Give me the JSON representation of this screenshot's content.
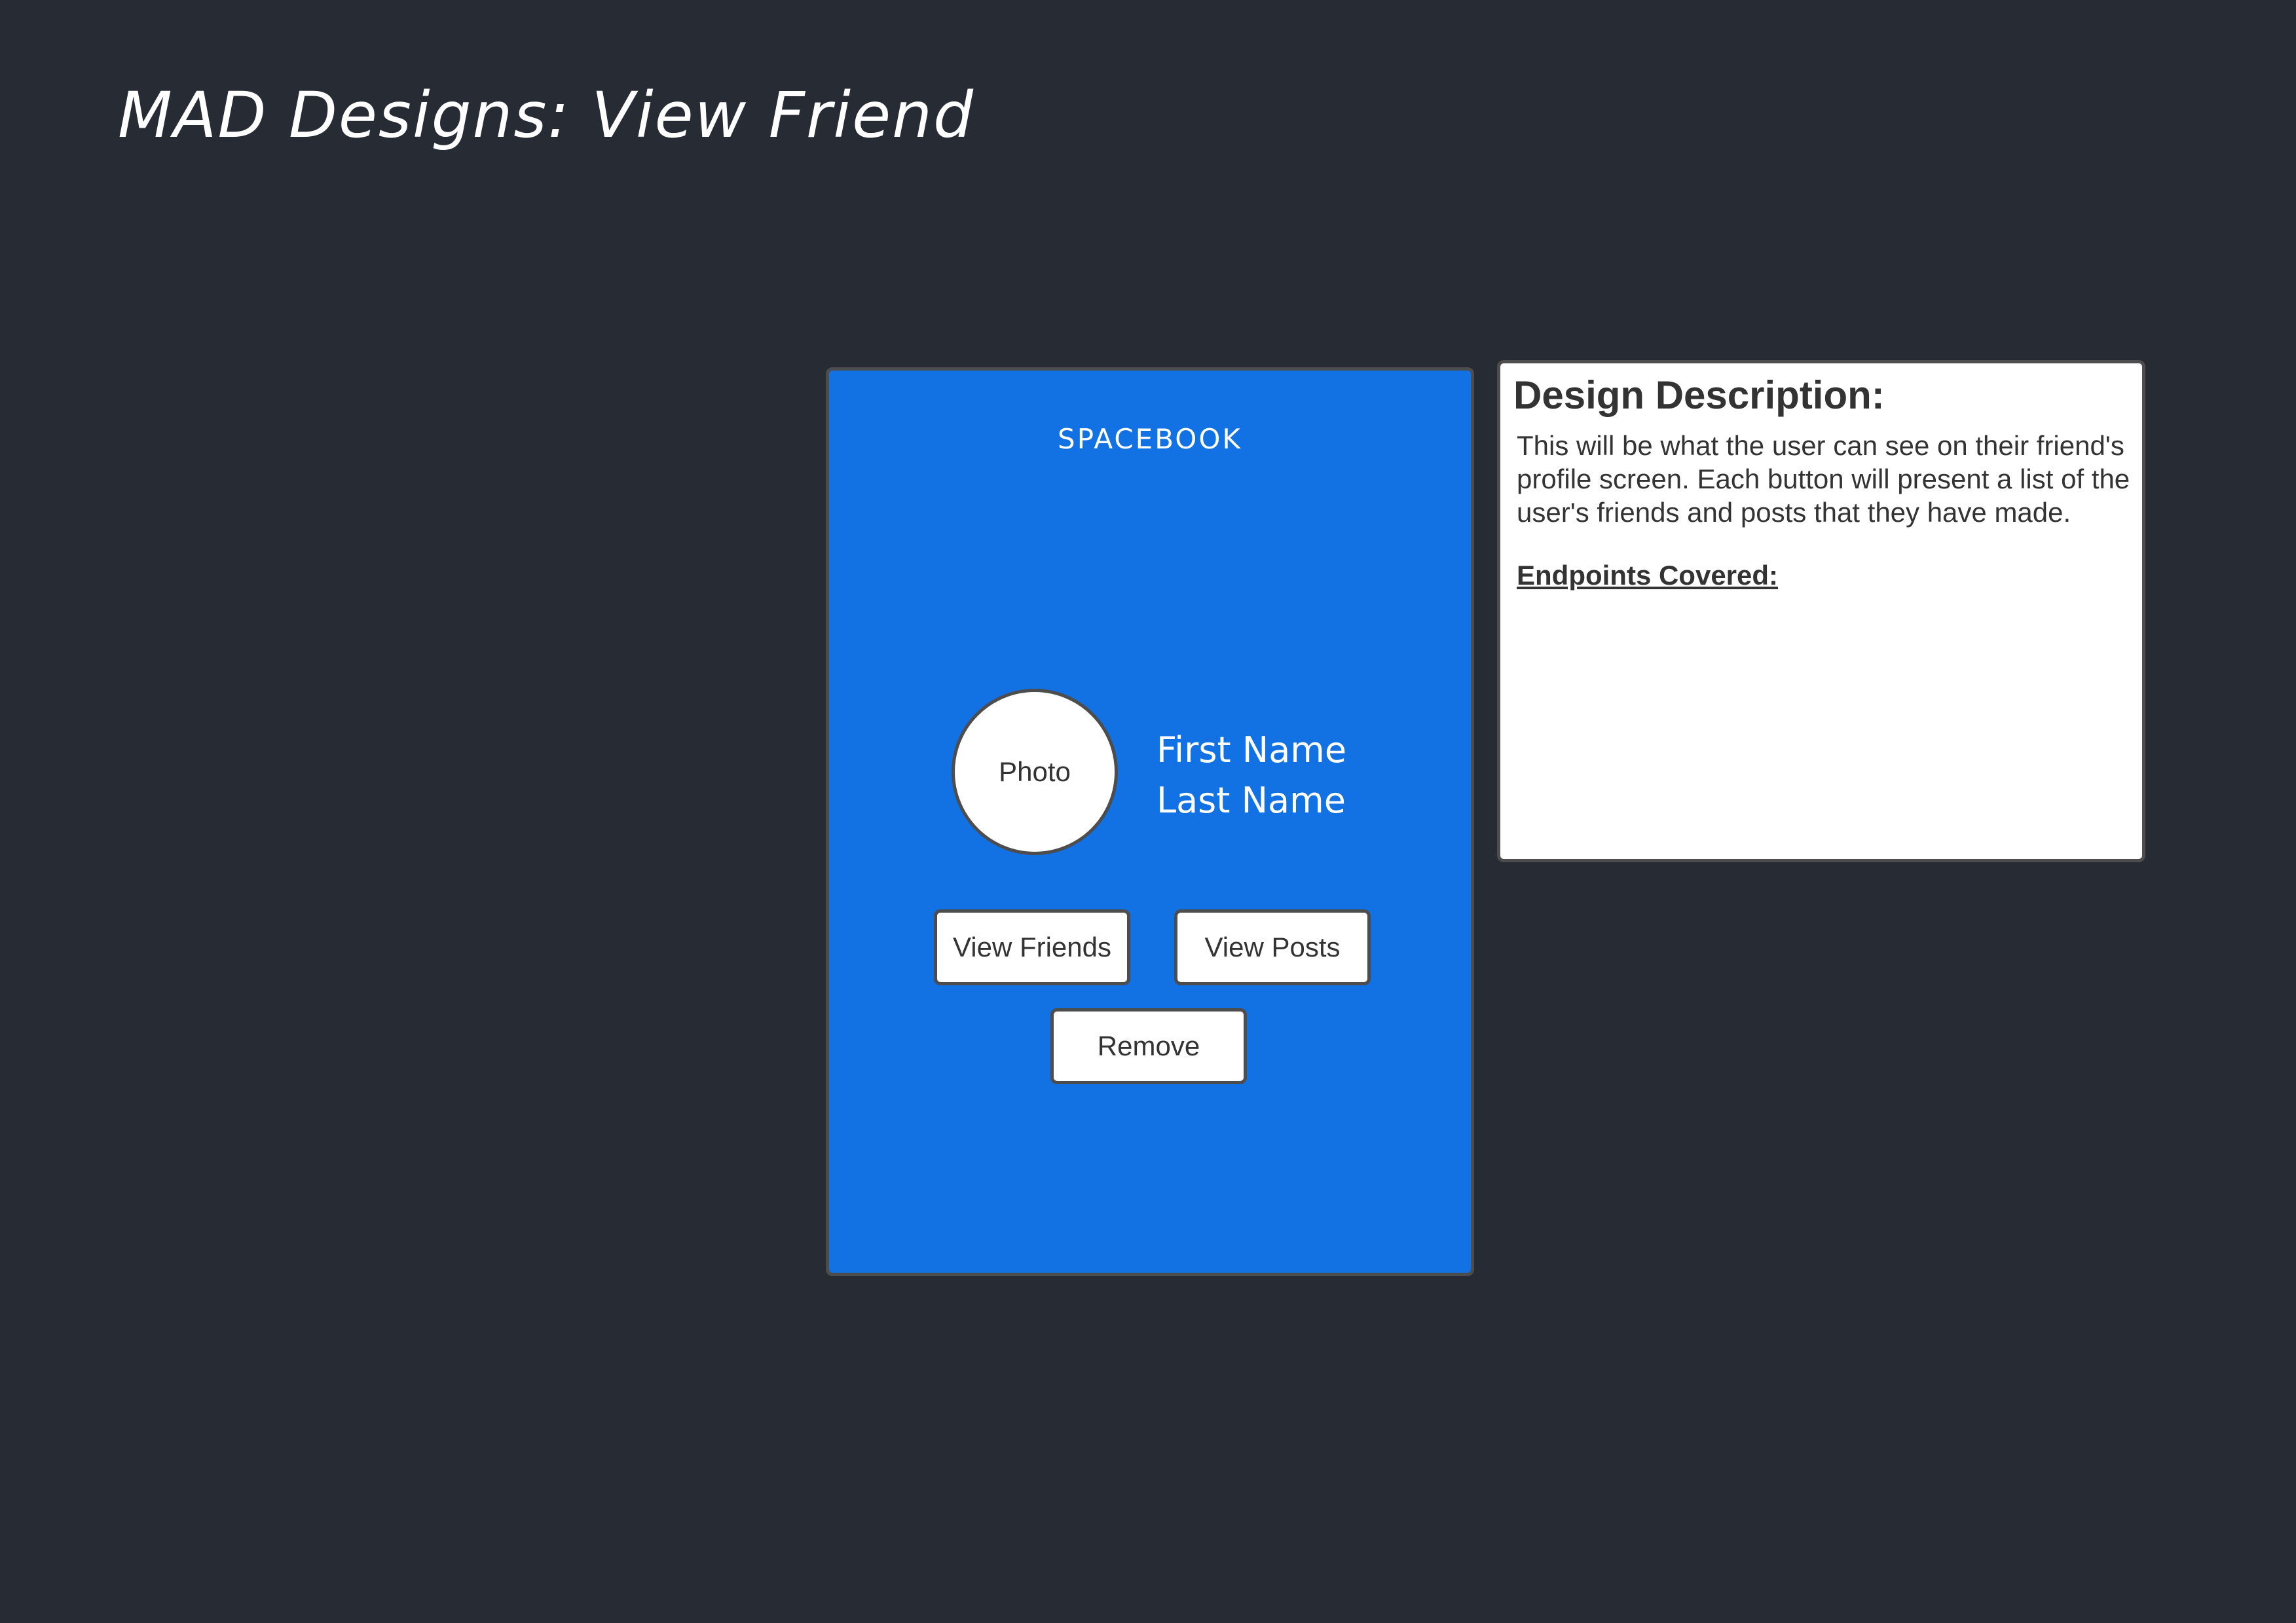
{
  "page": {
    "title": "MAD Designs: View Friend"
  },
  "mockup": {
    "brand": "SPACEBOOK",
    "photo_label": "Photo",
    "first_name": "First Name",
    "last_name": "Last Name",
    "buttons": {
      "view_friends": "View Friends",
      "view_posts": "View Posts",
      "remove": "Remove"
    }
  },
  "description": {
    "heading": "Design Description:",
    "body": "This will be what the user can see on their friend's profile screen. Each button will present a list of the user's friends and posts that they have made.",
    "endpoints_heading": "Endpoints Covered:"
  },
  "colors": {
    "background": "#272b33",
    "phone_screen": "#1271e3",
    "border": "#4d4d4d",
    "text_dark": "#333333"
  }
}
